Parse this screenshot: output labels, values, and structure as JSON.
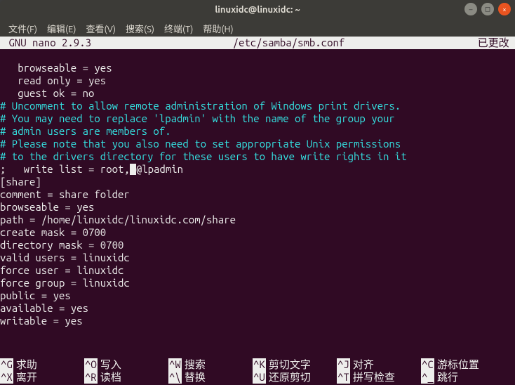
{
  "window": {
    "title": "linuxidc@linuxidc: ~"
  },
  "menubar": {
    "items": [
      "文件(F)",
      "编辑(E)",
      "查看(V)",
      "搜索(S)",
      "终端(T)",
      "帮助(H)"
    ]
  },
  "nano": {
    "header_left": " GNU nano 2.9.3 ",
    "header_file": "/etc/samba/smb.conf",
    "header_right": "已更改 ",
    "lines": [
      {
        "text": "",
        "comment": false
      },
      {
        "text": "   browseable = yes",
        "comment": false
      },
      {
        "text": "   read only = yes",
        "comment": false
      },
      {
        "text": "   guest ok = no",
        "comment": false
      },
      {
        "text": "# Uncomment to allow remote administration of Windows print drivers.",
        "comment": true
      },
      {
        "text": "# You may need to replace 'lpadmin' with the name of the group your",
        "comment": true
      },
      {
        "text": "# admin users are members of.",
        "comment": true
      },
      {
        "text": "# Please note that you also need to set appropriate Unix permissions",
        "comment": true
      },
      {
        "text": "# to the drivers directory for these users to have write rights in it",
        "comment": true
      },
      {
        "text_before": ";   write list = root,",
        "cursor": true,
        "text_after": "@lpadmin",
        "comment": false
      },
      {
        "text": "[share]",
        "comment": false
      },
      {
        "text": "comment = share folder",
        "comment": false
      },
      {
        "text": "browseable = yes",
        "comment": false
      },
      {
        "text": "path = /home/linuxidc/linuxidc.com/share",
        "comment": false
      },
      {
        "text": "create mask = 0700",
        "comment": false
      },
      {
        "text": "directory mask = 0700",
        "comment": false
      },
      {
        "text": "valid users = linuxidc",
        "comment": false
      },
      {
        "text": "force user = linuxidc",
        "comment": false
      },
      {
        "text": "force group = linuxidc",
        "comment": false
      },
      {
        "text": "public = yes",
        "comment": false
      },
      {
        "text": "available = yes",
        "comment": false
      },
      {
        "text": "writable = yes",
        "comment": false
      }
    ],
    "footer": {
      "row1": [
        {
          "key": "^G",
          "label": "求助"
        },
        {
          "key": "^O",
          "label": "写入"
        },
        {
          "key": "^W",
          "label": "搜索"
        },
        {
          "key": "^K",
          "label": "剪切文字"
        },
        {
          "key": "^J",
          "label": "对齐"
        },
        {
          "key": "^C",
          "label": "游标位置"
        }
      ],
      "row2": [
        {
          "key": "^X",
          "label": "离开"
        },
        {
          "key": "^R",
          "label": "读档"
        },
        {
          "key": "^\\",
          "label": "替换"
        },
        {
          "key": "^U",
          "label": "还原剪切"
        },
        {
          "key": "^T",
          "label": "拼写检查"
        },
        {
          "key": "^_",
          "label": "跳行"
        }
      ]
    }
  }
}
